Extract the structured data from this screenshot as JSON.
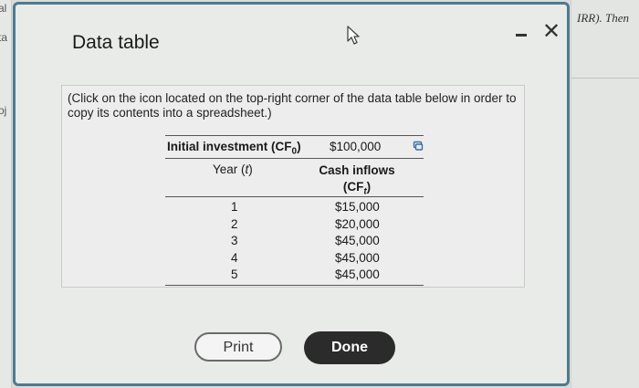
{
  "background": {
    "left_fragments": [
      "al",
      "ta",
      "oj"
    ],
    "right_text": "IRR). Then"
  },
  "dialog": {
    "title": "Data table",
    "instruction": "(Click on the icon located on the top-right corner of the data table below in order to copy its contents into a spreadsheet.)",
    "table": {
      "initial_investment_label": "Initial investment (CF",
      "initial_investment_sub": "0",
      "initial_investment_value": "$100,000",
      "col_year_label": "Year (",
      "col_year_var": "t",
      "col_cash_label": "Cash inflows",
      "col_cash_sub_open": "(CF",
      "col_cash_sub_var": "t",
      "rows": [
        {
          "year": "1",
          "cash": "$15,000"
        },
        {
          "year": "2",
          "cash": "$20,000"
        },
        {
          "year": "3",
          "cash": "$45,000"
        },
        {
          "year": "4",
          "cash": "$45,000"
        },
        {
          "year": "5",
          "cash": "$45,000"
        }
      ]
    },
    "buttons": {
      "print": "Print",
      "done": "Done"
    }
  },
  "colors": {
    "dialog_border": "#4f7a8e",
    "done_bg": "#2b2b2b"
  },
  "icons": [
    "cursor-icon",
    "minimize-icon",
    "close-icon",
    "copy-icon"
  ]
}
